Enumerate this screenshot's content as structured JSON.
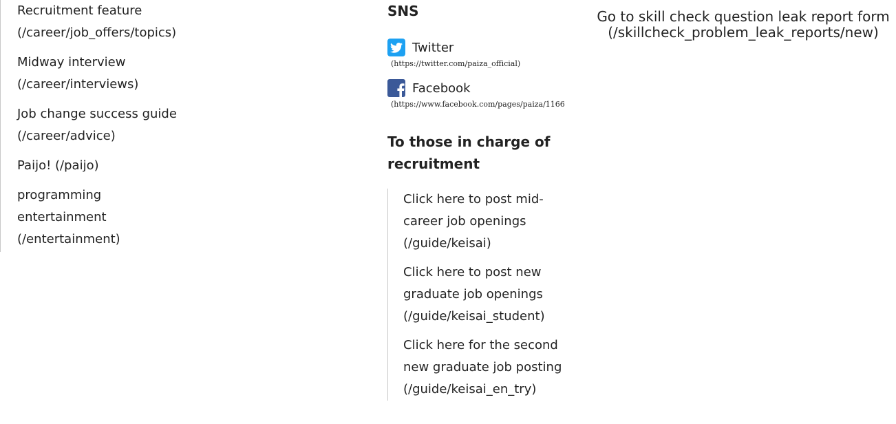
{
  "left_links": [
    {
      "label": "Recruitment feature",
      "path": "(/career/job_offers/topics)"
    },
    {
      "label": "Midway interview",
      "path": "(/career/interviews)"
    },
    {
      "label": "Job change success guide",
      "path": "(/career/advice)"
    },
    {
      "label": "Paijo! (/paijo)",
      "path": ""
    },
    {
      "label": "programming entertainment",
      "path": "(/entertainment)"
    }
  ],
  "sns": {
    "title": "SNS",
    "twitter_label": "Twitter",
    "twitter_url": "(https://twitter.com/paiza_official)",
    "facebook_label": "Facebook",
    "facebook_url": "(https://www.facebook.com/pages/paiza/1166"
  },
  "recruitment": {
    "title": "To those in charge of recruitment",
    "links": [
      {
        "label": "Click here to post mid-career job openings",
        "path": "(/guide/keisai)"
      },
      {
        "label": "Click here to post new graduate job openings",
        "path": "(/guide/keisai_student)"
      },
      {
        "label": "Click here for the second new graduate job posting",
        "path": "(/guide/keisai_en_try)"
      }
    ]
  },
  "leak_report": {
    "label": "Go to skill check question leak report form",
    "path": "(/skillcheck_problem_leak_reports/new)"
  },
  "colors": {
    "twitter": "#1da1f2",
    "facebook": "#3b5998"
  },
  "icons": [
    "twitter-icon",
    "facebook-icon"
  ]
}
